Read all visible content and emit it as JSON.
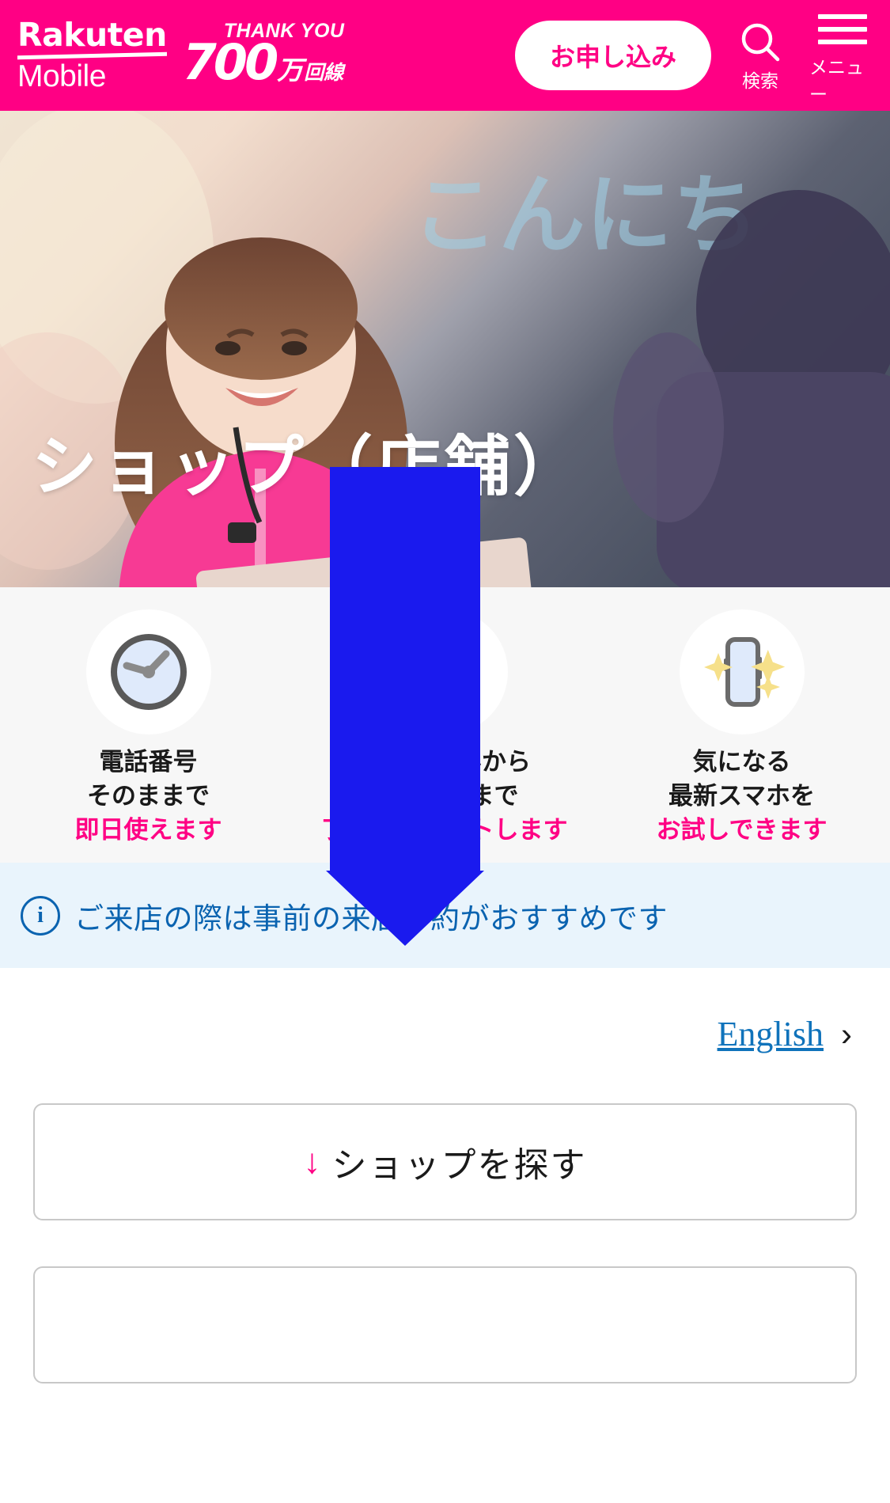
{
  "header": {
    "brand_line1": "Rakuten",
    "brand_line2": "Mobile",
    "campaign_thankyou": "THANK YOU",
    "campaign_number": "700",
    "campaign_man": "万",
    "campaign_kaisen": "回線",
    "apply_label": "お申し込み",
    "search_label": "検索",
    "menu_label": "メニュー",
    "search_icon": "search-icon",
    "menu_icon": "hamburger-menu-icon",
    "brand_color": "#ff0084"
  },
  "hero": {
    "title": "ショップ（店舗）",
    "image_description": "スタッフと来店客が店頭で話している写真"
  },
  "features": [
    {
      "icon": "clock-icon",
      "line1": "電話番号",
      "line2": "そのままで",
      "line3": "即日使えます"
    },
    {
      "icon": "staff-person-icon",
      "line1": "お申し込みから",
      "line2": "初期設定まで",
      "line3": "丁寧にサポートします"
    },
    {
      "icon": "smartphone-sparkle-icon",
      "line1": "気になる",
      "line2": "最新スマホを",
      "line3": "お試しできます"
    }
  ],
  "info_banner": {
    "icon": "info-circle-icon",
    "text": "ご来店の際は事前の来店予約がおすすめです",
    "color": "#0a63b0",
    "background": "#e9f4fc"
  },
  "language_link": {
    "label": "English",
    "chevron": "›"
  },
  "cta_buttons": [
    {
      "arrow": "↓",
      "label": "ショップを探す"
    },
    {
      "arrow": "",
      "label": ""
    }
  ],
  "overlay": {
    "annotation_arrow": "downward-blue-arrow",
    "color": "#1a1aee"
  },
  "colors": {
    "pink": "#ff0084",
    "link_blue": "#1073bb",
    "text_dark": "#1a1a1a",
    "feature_bg": "#f7f7f7"
  }
}
